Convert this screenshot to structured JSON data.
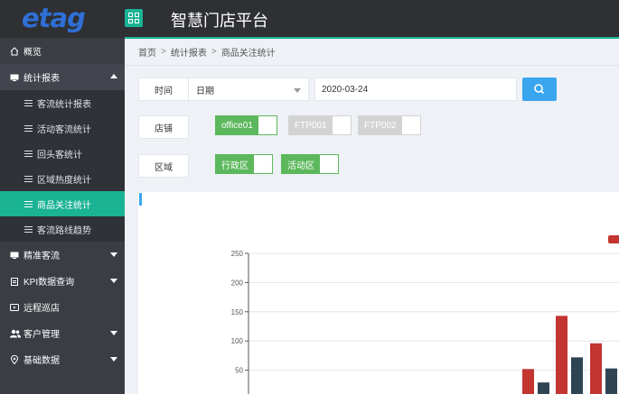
{
  "header": {
    "logo": "etag",
    "title": "智慧门店平台"
  },
  "sidebar": {
    "items": [
      {
        "label": "概览",
        "icon": "home-icon"
      },
      {
        "label": "统计报表",
        "icon": "chart-icon",
        "expanded": true,
        "children": [
          {
            "label": "客流统计报表"
          },
          {
            "label": "活动客流统计"
          },
          {
            "label": "回头客统计"
          },
          {
            "label": "区域热度统计"
          },
          {
            "label": "商品关注统计",
            "active": true
          },
          {
            "label": "客流路线趋势"
          }
        ]
      },
      {
        "label": "精准客流",
        "icon": "chart-icon"
      },
      {
        "label": "KPI数据查询",
        "icon": "clipboard-icon"
      },
      {
        "label": "远程巡店",
        "icon": "monitor-icon"
      },
      {
        "label": "客户管理",
        "icon": "users-icon"
      },
      {
        "label": "基础数据",
        "icon": "location-icon"
      }
    ]
  },
  "breadcrumb": [
    "首页",
    "统计报表",
    "商品关注统计"
  ],
  "filters": {
    "time_label": "时间",
    "time_select": "日期",
    "date_value": "2020-03-24",
    "store_label": "店铺",
    "stores": [
      {
        "label": "office01",
        "on": true
      },
      {
        "label": "FTP001",
        "on": false
      },
      {
        "label": "FTP002",
        "on": false
      }
    ],
    "area_label": "区域",
    "areas": [
      {
        "label": "行政区",
        "on": true
      },
      {
        "label": "活动区",
        "on": true
      }
    ]
  },
  "colors": {
    "accent": "#1ab394",
    "sidebar": "#3a3d44",
    "header": "#2e3034",
    "search": "#3aa6f0",
    "series_red": "#c23531",
    "series_dark": "#2f4554"
  },
  "chart_data": {
    "type": "bar",
    "ylim": [
      0,
      250
    ],
    "yticks": [
      50,
      100,
      150,
      200,
      250
    ],
    "grid": true,
    "legend": "top-right",
    "series": [
      {
        "color": "#c23531",
        "values": [
          52,
          143,
          96
        ]
      },
      {
        "color": "#2f4554",
        "values": [
          29,
          72,
          53
        ]
      }
    ]
  }
}
